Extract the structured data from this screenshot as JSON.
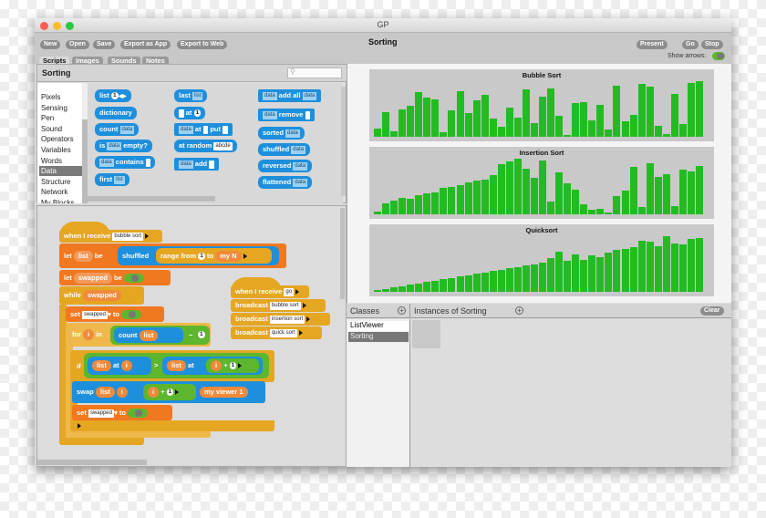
{
  "window": {
    "title": "GP",
    "app_title": "Sorting"
  },
  "toolbar": {
    "buttons": [
      "New",
      "Open",
      "Save",
      "Export as App",
      "Export to Web"
    ],
    "present": "Present",
    "go": "Go",
    "stop": "Stop",
    "show_arrows_label": "Show arrows:",
    "show_arrows_on": true
  },
  "tabs": [
    "Scripts",
    "Images",
    "Sounds",
    "Notes"
  ],
  "palette": {
    "class_name": "Sorting",
    "search_placeholder": "",
    "categories": [
      "Pixels",
      "Sensing",
      "Pen",
      "Sound",
      "Operators",
      "Variables",
      "Words",
      "Data",
      "Structure",
      "Network",
      "My Blocks"
    ],
    "selected_category": "Data"
  },
  "palette_blocks": {
    "list": "list",
    "list_num": "1",
    "dictionary": "dictionary",
    "count": "count",
    "data": "data",
    "is": "is",
    "empty": "empty?",
    "contains": "contains",
    "first": "first",
    "list_slot": "list",
    "last": "last",
    "at": "at",
    "one": "1",
    "put": "put",
    "at_random": "at random",
    "abcde": "abcde",
    "add": "add",
    "add_all": "add all",
    "remove": "remove",
    "sorted": "sorted",
    "shuffled": "shuffled",
    "reversed": "reversed",
    "flattened": "flattened"
  },
  "script": {
    "when_i_receive": "when I receive",
    "bubble_sort": "bubble sort",
    "let": "let",
    "list": "list",
    "be": "be",
    "shuffled": "shuffled",
    "range_from": "range from",
    "one": "1",
    "to": "to",
    "my_n": "my N",
    "swapped": "swapped",
    "while": "while",
    "set": "set",
    "for": "for",
    "i": "i",
    "in": "in",
    "count": "count",
    "minus": "−",
    "if": "if",
    "at": "at",
    "gt": ">",
    "plus": "+",
    "swap": "swap",
    "my_viewer": "my viewer 1"
  },
  "script2": {
    "when_i_receive": "when I receive",
    "go": "go",
    "broadcast": "broadcast",
    "messages": [
      "bubble sort",
      "insertion sort",
      "quick sort"
    ]
  },
  "bottom": {
    "classes_label": "Classes",
    "classes": [
      "ListViewer",
      "Sorting"
    ],
    "selected_class": "Sorting",
    "instances_label": "Instances of Sorting",
    "clear": "Clear"
  },
  "colors": {
    "bar": "#22bb22",
    "control": "#e5a622",
    "variables": "#f07820",
    "data": "#1e8fdc",
    "operators": "#5db62d"
  },
  "chart_data": [
    {
      "type": "bar",
      "title": "Bubble Sort",
      "values": [
        6,
        18,
        4,
        20,
        22,
        32,
        28,
        27,
        3,
        19,
        33,
        17,
        26,
        30,
        13,
        7,
        21,
        14,
        34,
        10,
        29,
        35,
        15,
        1,
        24,
        25,
        12,
        23,
        5,
        37,
        11,
        16,
        38,
        36,
        8,
        2,
        31,
        9,
        39,
        40
      ],
      "ylim": [
        0,
        40
      ]
    },
    {
      "type": "bar",
      "title": "Insertion Sort",
      "values": [
        2,
        8,
        10,
        12,
        11,
        14,
        15,
        16,
        19,
        20,
        21,
        23,
        24,
        25,
        28,
        36,
        38,
        40,
        33,
        26,
        39,
        9,
        30,
        22,
        18,
        7,
        3,
        4,
        1,
        13,
        17,
        34,
        5,
        37,
        27,
        29,
        6,
        32,
        31,
        35
      ],
      "ylim": [
        0,
        40
      ]
    },
    {
      "type": "bar",
      "title": "Quicksort",
      "values": [
        1,
        2,
        3,
        4,
        5,
        6,
        7,
        8,
        9,
        10,
        11,
        12,
        13,
        14,
        15,
        16,
        17,
        18,
        19,
        20,
        21,
        24,
        29,
        22,
        27,
        23,
        26,
        25,
        28,
        30,
        31,
        32,
        37,
        36,
        33,
        40,
        35,
        34,
        38,
        39
      ],
      "ylim": [
        0,
        40
      ]
    }
  ]
}
